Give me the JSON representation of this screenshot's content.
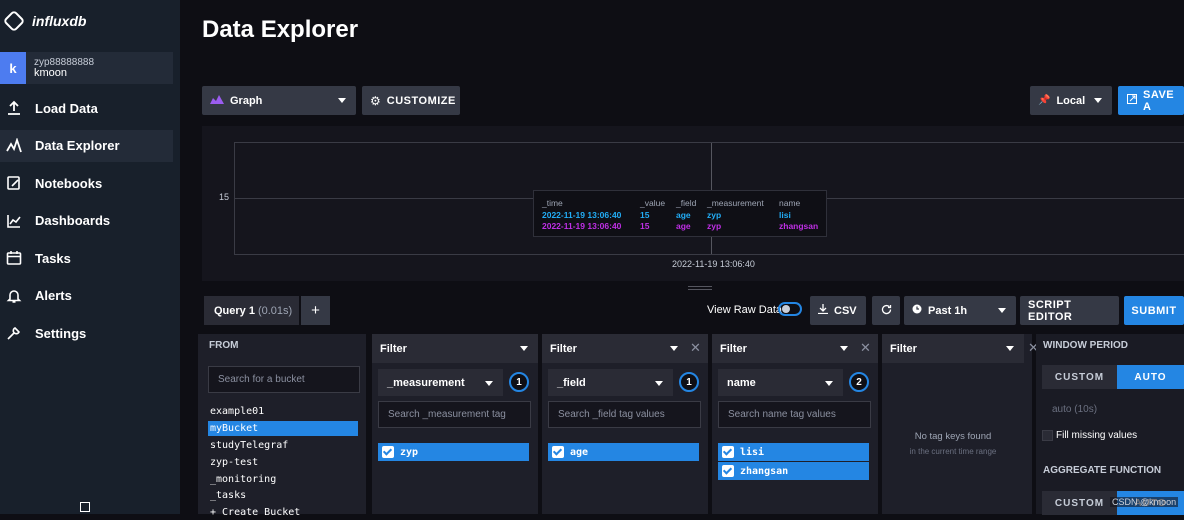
{
  "app": {
    "logo_text": "influxdb"
  },
  "user": {
    "initial": "k",
    "username": "zyp88888888",
    "org": "kmoon"
  },
  "nav": [
    {
      "label": "Load Data",
      "icon": "upload-icon"
    },
    {
      "label": "Data Explorer",
      "icon": "graph-line-icon"
    },
    {
      "label": "Notebooks",
      "icon": "notebook-icon"
    },
    {
      "label": "Dashboards",
      "icon": "dashboard-icon"
    },
    {
      "label": "Tasks",
      "icon": "calendar-icon"
    },
    {
      "label": "Alerts",
      "icon": "bell-icon"
    },
    {
      "label": "Settings",
      "icon": "wrench-icon"
    }
  ],
  "page": {
    "title": "Data Explorer"
  },
  "toolbar": {
    "graph_type": "Graph",
    "customize": "CUSTOMIZE",
    "timezone": "Local",
    "save_as": "SAVE A"
  },
  "graph": {
    "y_tick": "15",
    "x_tick": "2022-11-19 13:06:40",
    "tooltip": {
      "headers": [
        "_time",
        "_value",
        "_field",
        "_measurement",
        "name"
      ],
      "rows": [
        {
          "time": "2022-11-19 13:06:40",
          "value": "15",
          "field": "age",
          "measurement": "zyp",
          "name": "lisi",
          "color": "#22adf6"
        },
        {
          "time": "2022-11-19 13:06:40",
          "value": "15",
          "field": "age",
          "measurement": "zyp",
          "name": "zhangsan",
          "color": "#bf2fe5"
        }
      ]
    }
  },
  "query_bar": {
    "tab_label": "Query 1",
    "tab_time": "(0.01s)",
    "add": "+",
    "raw_data_label": "View Raw Data",
    "csv": "CSV",
    "time_range": "Past 1h",
    "script_editor": "SCRIPT EDITOR",
    "submit": "SUBMIT"
  },
  "from": {
    "header": "FROM",
    "search_placeholder": "Search for a bucket",
    "buckets": [
      "example01",
      "myBucket",
      "studyTelegraf",
      "zyp-test",
      "_monitoring",
      "_tasks",
      "+ Create Bucket"
    ],
    "selected": "myBucket"
  },
  "filters": [
    {
      "header": "Filter",
      "key": "_measurement",
      "count": "1",
      "search": "Search _measurement tag",
      "values": [
        "zyp"
      ]
    },
    {
      "header": "Filter",
      "key": "_field",
      "count": "1",
      "search": "Search _field tag values",
      "values": [
        "age"
      ]
    },
    {
      "header": "Filter",
      "key": "name",
      "count": "2",
      "search": "Search name tag values",
      "values": [
        "lisi",
        "zhangsan"
      ]
    },
    {
      "header": "Filter",
      "empty_line1": "No tag keys found",
      "empty_line2": "in the current time range"
    }
  ],
  "window": {
    "header": "WINDOW PERIOD",
    "custom": "CUSTOM",
    "auto": "AUTO",
    "auto_value": "auto (10s)",
    "fill_missing": "Fill missing values",
    "aggregate_header": "AGGREGATE FUNCTION",
    "agg_custom": "CUSTOM",
    "agg_auto": "AUTO"
  },
  "watermark": "CSDN @kmoon"
}
